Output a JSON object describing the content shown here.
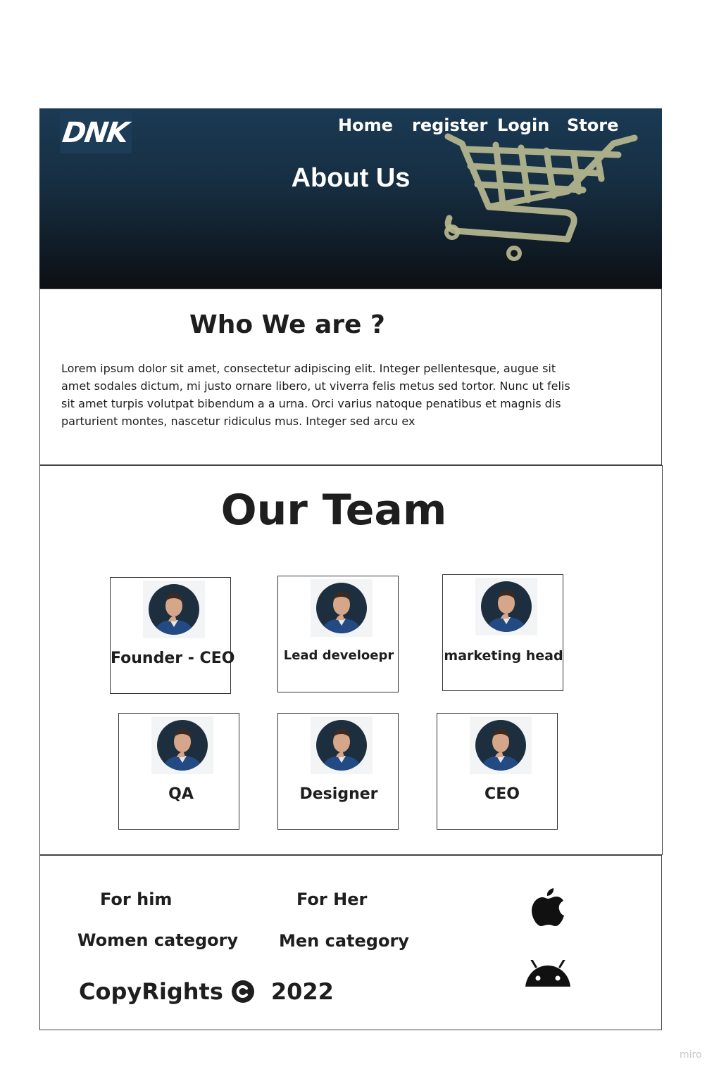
{
  "header": {
    "logo_text": "DNK",
    "nav": [
      "Home",
      "register",
      "Login",
      "Store"
    ],
    "title": "About Us",
    "colors": {
      "background_top": "#1a3a54",
      "background_bottom": "#0d0f12",
      "text": "#ffffff"
    },
    "icon": "shopping-cart-icon"
  },
  "who": {
    "title": "Who We are ?",
    "text": "Lorem ipsum dolor sit amet, consectetur adipiscing elit. Integer pellentesque, augue sit amet sodales dictum, mi justo ornare libero, ut viverra felis metus sed tortor. Nunc ut felis sit amet turpis volutpat bibendum a a urna. Orci varius natoque penatibus et magnis dis parturient montes, nascetur ridiculus mus. Integer sed arcu ex"
  },
  "team": {
    "title": "Our Team",
    "members": [
      {
        "role": "Founder - CEO"
      },
      {
        "role": "Lead develoepr"
      },
      {
        "role": "marketing head"
      },
      {
        "role": "QA"
      },
      {
        "role": "Designer"
      },
      {
        "role": "CEO"
      }
    ]
  },
  "footer": {
    "for_him": "For him",
    "for_her": "For Her",
    "women_category": "Women category",
    "men_category": "Men category",
    "copyright_label": "CopyRights",
    "copyright_year": "2022",
    "icons": [
      "copyright-icon",
      "apple-icon",
      "android-icon"
    ]
  },
  "watermark": "miro"
}
